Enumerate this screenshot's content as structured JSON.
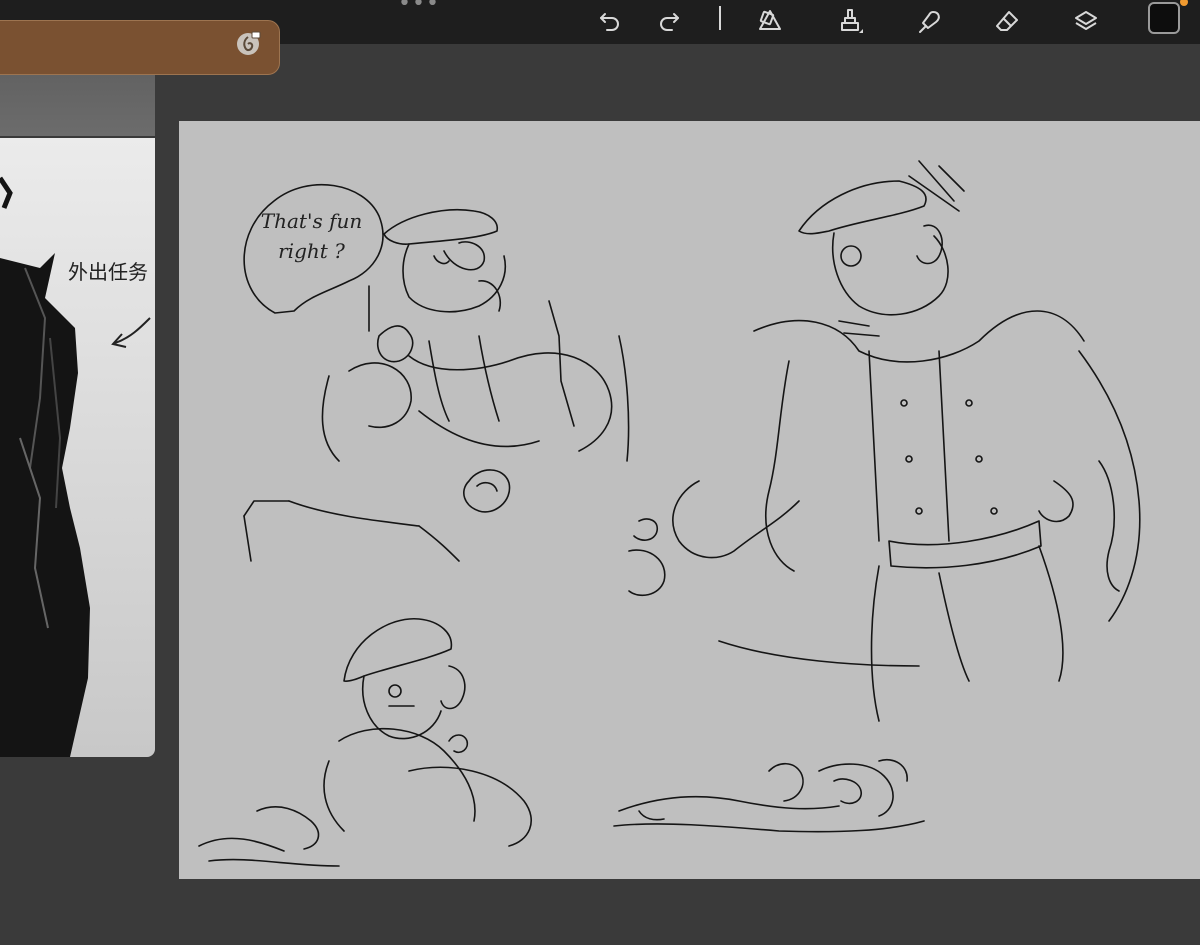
{
  "toolbar": {
    "items": [
      {
        "name": "undo-icon"
      },
      {
        "name": "redo-icon"
      },
      {
        "name": "selection-icon"
      },
      {
        "name": "brush-icon"
      },
      {
        "name": "smudge-icon"
      },
      {
        "name": "eraser-icon"
      },
      {
        "name": "layers-icon"
      }
    ],
    "active_color": "#0d0d0d",
    "notification_color": "#f09a30"
  },
  "reference": {
    "bar_color": "#7a5131",
    "caption": "外出任务"
  },
  "canvas": {
    "background": "#bfbfbf",
    "speech_bubble": {
      "line1": "That's fun",
      "line2": "right ?"
    }
  }
}
